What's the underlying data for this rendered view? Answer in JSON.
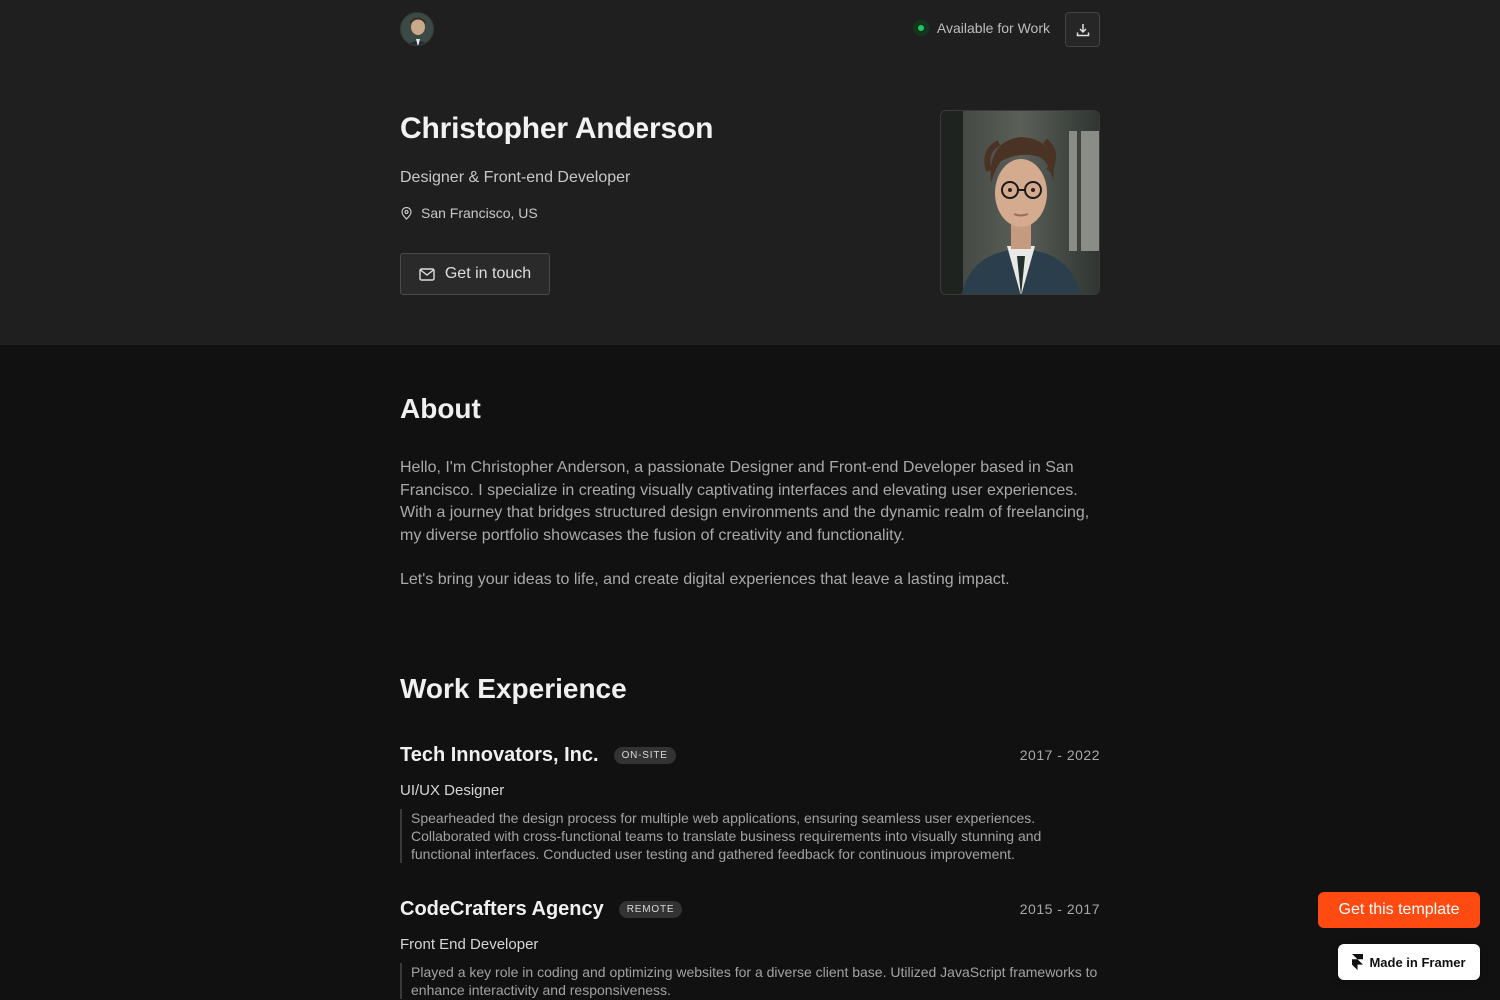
{
  "header": {
    "availability": "Available for Work",
    "avatar_icon": "avatar",
    "download_icon": "download-icon"
  },
  "hero": {
    "name": "Christopher Anderson",
    "role": "Designer & Front-end Developer",
    "location": "San Francisco, US",
    "contact_label": "Get in touch"
  },
  "about": {
    "title": "About",
    "paragraphs": [
      "Hello, I'm Christopher Anderson, a passionate Designer and Front-end Developer based in San Francisco. I specialize in creating visually captivating interfaces and elevating user experiences. With a journey that bridges structured design environments and the dynamic realm of freelancing, my diverse portfolio showcases the fusion of creativity and functionality.",
      "Let's bring your ideas to life, and create digital experiences that leave a lasting impact."
    ]
  },
  "work": {
    "title": "Work Experience",
    "jobs": [
      {
        "company": "Tech Innovators, Inc.",
        "badge": "ON-SITE",
        "years": "2017 - 2022",
        "title": "UI/UX Designer",
        "description": "Spearheaded the design process for multiple web applications, ensuring seamless user experiences. Collaborated with cross-functional teams to translate business requirements into visually stunning and functional interfaces. Conducted user testing and gathered feedback for continuous improvement."
      },
      {
        "company": "CodeCrafters Agency",
        "badge": "REMOTE",
        "years": "2015 - 2017",
        "title": "Front End Developer",
        "description": "Played a key role in coding and optimizing websites for a diverse client base. Utilized JavaScript frameworks to enhance interactivity and responsiveness."
      }
    ]
  },
  "floating": {
    "cta_label": "Get this template",
    "framer_label": "Made in Framer"
  },
  "colors": {
    "accent": "#ff4a12",
    "status": "#22c55e",
    "hero_bg": "#1f1f1f",
    "page_bg": "#111111"
  }
}
